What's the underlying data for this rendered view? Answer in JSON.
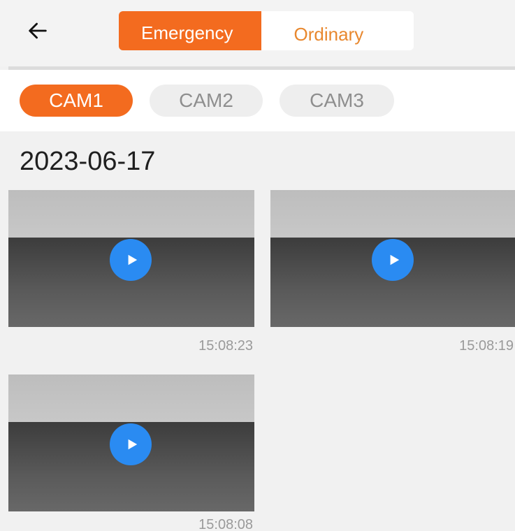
{
  "header": {
    "back_icon": "arrow-left-icon",
    "tabs": [
      {
        "label": "Emergency",
        "active": true
      },
      {
        "label": "Ordinary",
        "active": false
      }
    ]
  },
  "cameras": [
    {
      "label": "CAM1",
      "active": true
    },
    {
      "label": "CAM2",
      "active": false
    },
    {
      "label": "CAM3",
      "active": false
    }
  ],
  "groups": [
    {
      "date": "2023-06-17",
      "videos": [
        {
          "time": "15:08:23",
          "icon": "play-icon"
        },
        {
          "time": "15:08:19",
          "icon": "play-icon"
        },
        {
          "time": "15:08:08",
          "icon": "play-icon"
        }
      ]
    }
  ],
  "colors": {
    "accent": "#f36b1f",
    "inactive_tab_text": "#e8882f",
    "play_button": "#2a8bf2"
  }
}
